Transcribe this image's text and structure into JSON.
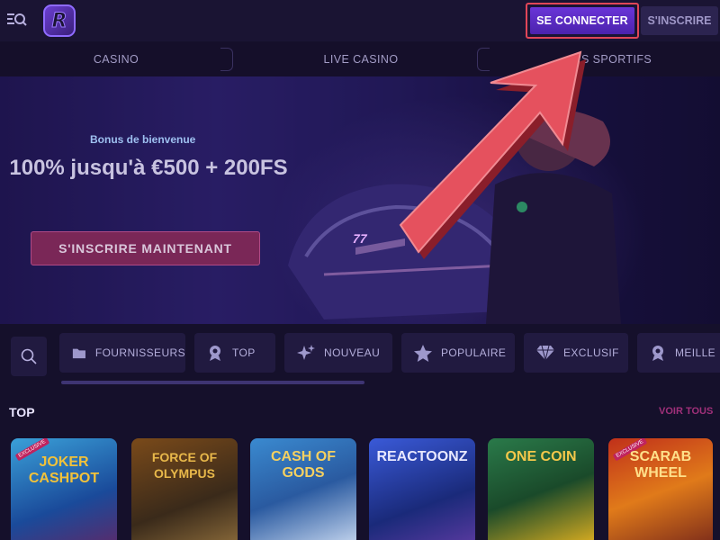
{
  "header": {
    "logo_letter": "R",
    "login_label": "SE CONNECTER",
    "register_label": "S'INSCRIRE"
  },
  "tabs": [
    "CASINO",
    "LIVE CASINO",
    "S SPORTIFS"
  ],
  "hero": {
    "bonus_label": "Bonus de bienvenue",
    "bonus_title": "100% jusqu'à €500 + 200FS",
    "cta_label": "S'INSCRIRE MAINTENANT",
    "bike_plate": "77"
  },
  "categories": [
    {
      "label": "FOURNISSEURS",
      "icon": "folder-icon"
    },
    {
      "label": "TOP",
      "icon": "medal-icon"
    },
    {
      "label": "NOUVEAU",
      "icon": "sparkle-icon"
    },
    {
      "label": "POPULAIRE",
      "icon": "star-icon"
    },
    {
      "label": "EXCLUSIF",
      "icon": "diamond-icon"
    },
    {
      "label": "MEILLE",
      "icon": "medal-icon"
    }
  ],
  "section": {
    "title": "TOP",
    "view_all": "VOIR TOUS"
  },
  "games": [
    {
      "name": "JOKER CASHPOT",
      "badge": "EXCLUSIVE"
    },
    {
      "name": "FORCE OF OLYMPUS",
      "badge": ""
    },
    {
      "name": "CASH OF GODS",
      "badge": ""
    },
    {
      "name": "REACTOONZ",
      "badge": ""
    },
    {
      "name": "ONE COIN",
      "badge": ""
    },
    {
      "name": "SCARAB WHEEL",
      "badge": "EXCLUSIVE"
    }
  ],
  "colors": {
    "accent": "#5a2fc4",
    "highlight": "#e04658",
    "cta": "#7a2757",
    "view_all": "#a0307a"
  }
}
